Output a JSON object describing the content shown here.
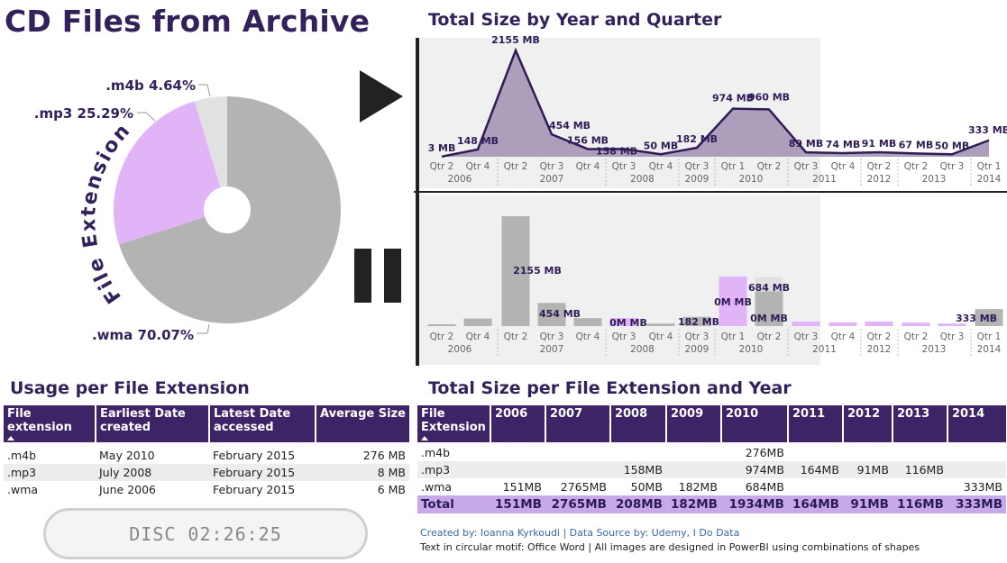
{
  "title": "CD Files from Archive",
  "donut": {
    "circular_text": "File Extension",
    "slices": [
      {
        "name": ".wma",
        "percent": 70.07,
        "label": ".wma 70.07%",
        "color": "#b3b3b3"
      },
      {
        "name": ".mp3",
        "percent": 25.29,
        "label": ".mp3 25.29%",
        "color": "#e1b4f7"
      },
      {
        "name": ".m4b",
        "percent": 4.64,
        "label": ".m4b 4.64%",
        "color": "#e1e1e1"
      }
    ]
  },
  "area_chart": {
    "title": "Total Size by Year and Quarter"
  },
  "bar_chart": {},
  "chart_data": [
    {
      "type": "area",
      "title": "Total Size by Year and Quarter",
      "x": [
        "2006 Qtr 2",
        "2006 Qtr 4",
        "2007 Qtr 2",
        "2007 Qtr 3",
        "2007 Qtr 4",
        "2008 Qtr 3",
        "2008 Qtr 4",
        "2009 Qtr 3",
        "2010 Qtr 1",
        "2010 Qtr 2",
        "2011 Qtr 3",
        "2011 Qtr 4",
        "2012 Qtr 2",
        "2013 Qtr 2",
        "2013 Qtr 3",
        "2014 Qtr 1"
      ],
      "quarters": [
        "Qtr 2",
        "Qtr 4",
        "Qtr 2",
        "Qtr 3",
        "Qtr 4",
        "Qtr 3",
        "Qtr 4",
        "Qtr 3",
        "Qtr 1",
        "Qtr 2",
        "Qtr 3",
        "Qtr 4",
        "Qtr 2",
        "Qtr 2",
        "Qtr 3",
        "Qtr 1"
      ],
      "years": [
        "2006",
        "2007",
        "2008",
        "2009",
        "2010",
        "2011",
        "2012",
        "2013",
        "2014"
      ],
      "values": [
        3,
        148,
        2155,
        454,
        156,
        158,
        50,
        182,
        974,
        960,
        89,
        74,
        91,
        67,
        50,
        333
      ],
      "labels": [
        "3 MB",
        "148 MB",
        "2155 MB",
        "454 MB",
        "156 MB",
        "158 MB",
        "50 MB",
        "182 MB",
        "974 MB",
        "960 MB",
        "89 MB",
        "74 MB",
        "91 MB",
        "67 MB",
        "50 MB",
        "333 MB"
      ],
      "ylabel": "",
      "xlabel": ""
    },
    {
      "type": "bar",
      "x": [
        "2006 Qtr 2",
        "2006 Qtr 4",
        "2007 Qtr 2",
        "2007 Qtr 3",
        "2007 Qtr 4",
        "2008 Qtr 3",
        "2008 Qtr 4",
        "2009 Qtr 3",
        "2010 Qtr 1",
        "2010 Qtr 2",
        "2011 Qtr 3",
        "2011 Qtr 4",
        "2012 Qtr 2",
        "2013 Qtr 2",
        "2013 Qtr 3",
        "2014 Qtr 1"
      ],
      "series": [
        {
          "name": ".wma",
          "color": "#b3b3b3",
          "values": [
            3,
            148,
            2155,
            454,
            156,
            0,
            50,
            182,
            0,
            684,
            0,
            0,
            0,
            0,
            0,
            333
          ]
        },
        {
          "name": ".mp3",
          "color": "#e1b4f7",
          "values": [
            0,
            0,
            0,
            0,
            0,
            158,
            0,
            0,
            974,
            0,
            89,
            74,
            91,
            67,
            50,
            0
          ]
        },
        {
          "name": ".m4b",
          "color": "#e1e1e1",
          "values": [
            0,
            0,
            0,
            0,
            0,
            0,
            0,
            0,
            0,
            276,
            0,
            0,
            0,
            0,
            0,
            0
          ]
        }
      ],
      "data_labels": [
        {
          "index": 2,
          "text": "2155 MB"
        },
        {
          "index": 3,
          "text": "454 MB"
        },
        {
          "index": 5,
          "text": "0M MB"
        },
        {
          "index": 7,
          "text": "182 MB"
        },
        {
          "index": 8,
          "text": "0M MB"
        },
        {
          "index": 9,
          "text": "684 MB"
        },
        {
          "index": 9,
          "text": "0M MB"
        },
        {
          "index": 15,
          "text": "333 MB"
        }
      ]
    }
  ],
  "usage": {
    "title": "Usage per File Extension",
    "headers": [
      "File extension",
      "Earliest Date created",
      "Latest Date accessed",
      "Average Size"
    ],
    "rows": [
      [
        ".m4b",
        "May 2010",
        "February 2015",
        "276 MB"
      ],
      [
        ".mp3",
        "July 2008",
        "February 2015",
        "8 MB"
      ],
      [
        ".wma",
        "June 2006",
        "February 2015",
        "6 MB"
      ]
    ]
  },
  "ext_year": {
    "title": "Total Size per File Extension and Year",
    "headers": [
      "File Extension",
      "2006",
      "2007",
      "2008",
      "2009",
      "2010",
      "2011",
      "2012",
      "2013",
      "2014"
    ],
    "rows": [
      [
        ".m4b",
        "",
        "",
        "",
        "",
        "276MB",
        "",
        "",
        "",
        ""
      ],
      [
        ".mp3",
        "",
        "",
        "158MB",
        "",
        "974MB",
        "164MB",
        "91MB",
        "116MB",
        ""
      ],
      [
        ".wma",
        "151MB",
        "2765MB",
        "50MB",
        "182MB",
        "684MB",
        "",
        "",
        "",
        "333MB"
      ]
    ],
    "total": [
      "Total",
      "151MB",
      "2765MB",
      "208MB",
      "182MB",
      "1934MB",
      "164MB",
      "91MB",
      "116MB",
      "333MB"
    ]
  },
  "disc_display": "DISC 02:26:25",
  "credits": {
    "line1": "Created by: Ioanna Kyrkoudi | Data Source by: Udemy, I Do Data",
    "line2": "Text in circular motif: Office Word | All images are designed in PowerBI using combinations of shapes"
  }
}
